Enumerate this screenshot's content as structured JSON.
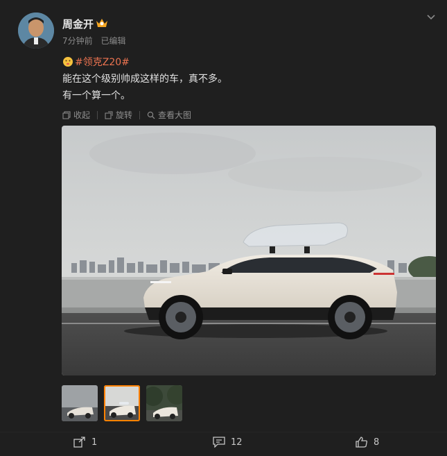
{
  "post": {
    "username": "周金开",
    "time": "7分钟前",
    "edited": "已编辑",
    "hashtag": "#领克Z20#",
    "line1": "能在这个级别帅成这样的车，真不多。",
    "line2": "有一个算一个。"
  },
  "toolbar": {
    "collect": "收起",
    "rotate": "旋转",
    "view_large": "查看大图"
  },
  "thumbnails": {
    "count": 3,
    "active_index": 1
  },
  "actions": {
    "share_count": "1",
    "comment_count": "12",
    "like_count": "8"
  },
  "colors": {
    "hashtag": "#eb7350",
    "active_thumb_border": "#ff8200"
  },
  "icons": [
    "crown-icon",
    "collapse-chevron-icon",
    "emoji-icon",
    "collect-icon",
    "rotate-icon",
    "view-large-icon",
    "share-icon",
    "comment-icon",
    "like-icon"
  ]
}
